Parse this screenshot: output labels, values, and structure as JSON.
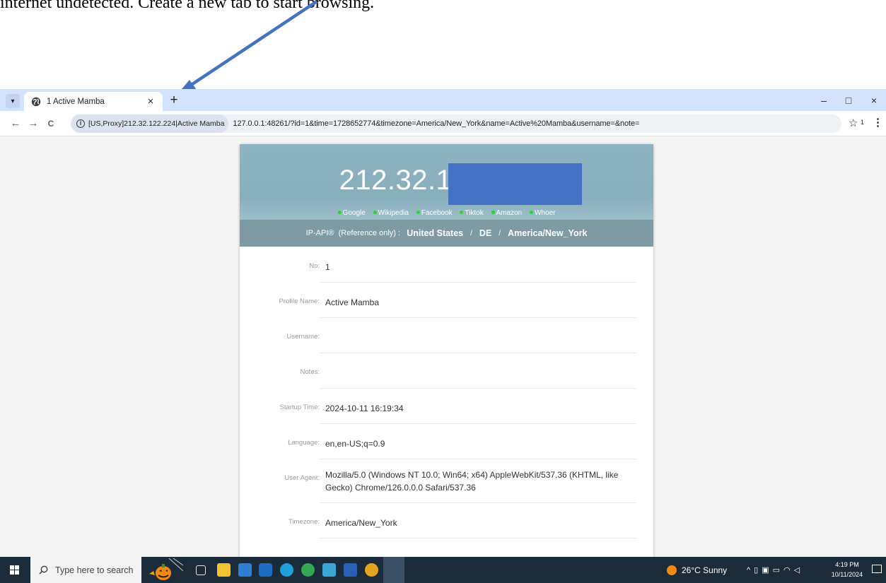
{
  "caption": {
    "text": "internet undetected. Create a new tab to start browsing."
  },
  "browser": {
    "tab_title": "1 Active Mamba",
    "close_glyph": "×",
    "new_tab_glyph": "+",
    "window_controls": {
      "minimize": "–",
      "maximize": "□",
      "close": "×"
    },
    "nav": {
      "back": "←",
      "forward": "→",
      "reload": "C"
    },
    "site_chip": "[US,Proxy]212.32.122.224|Active Mamba",
    "url": "127.0.0.1:48261/?id=1&time=1728652774&timezone=America/New_York&name=Active%20Mamba&username=&note=",
    "star": "☆",
    "extension_count": "1",
    "menu": "⋮"
  },
  "page": {
    "ip_visible": "212.32.1",
    "links": [
      "Google",
      "Wikipedia",
      "Facebook",
      "Tiktok",
      "Amazon",
      "Whoer"
    ],
    "geo": {
      "source": "IP-API®",
      "note": "(Reference only)",
      "colon": ":",
      "country": "United States",
      "region": "DE",
      "timezone": "America/New_York",
      "sep": "/"
    },
    "fields": [
      {
        "label": "No:",
        "value": "1"
      },
      {
        "label": "Profile Name:",
        "value": "Active Mamba"
      },
      {
        "label": "Username:",
        "value": ""
      },
      {
        "label": "Notes:",
        "value": ""
      },
      {
        "label": "Startup Time:",
        "value": "2024-10-11 16:19:34"
      },
      {
        "label": "Language:",
        "value": "en,en-US;q=0.9"
      },
      {
        "label": "User Agent:",
        "value": "Mozilla/5.0 (Windows NT 10.0; Win64; x64) AppleWebKit/537.36 (KHTML, like Gecko) Chrome/126.0.0.0 Safari/537.36"
      },
      {
        "label": "Timezone:",
        "value": "America/New_York"
      }
    ]
  },
  "taskbar": {
    "search_placeholder": "Type here to search",
    "weather": "26°C  Sunny",
    "time": "4:19 PM",
    "date": "10/11/2024"
  },
  "colors": {
    "tabbar": "#d3e3fd",
    "header": "#8fb4c1",
    "geo_bar": "#7e9ba4",
    "redaction": "#4472c4",
    "arrow": "#4472c4",
    "taskbar": "#1c2b3a"
  }
}
